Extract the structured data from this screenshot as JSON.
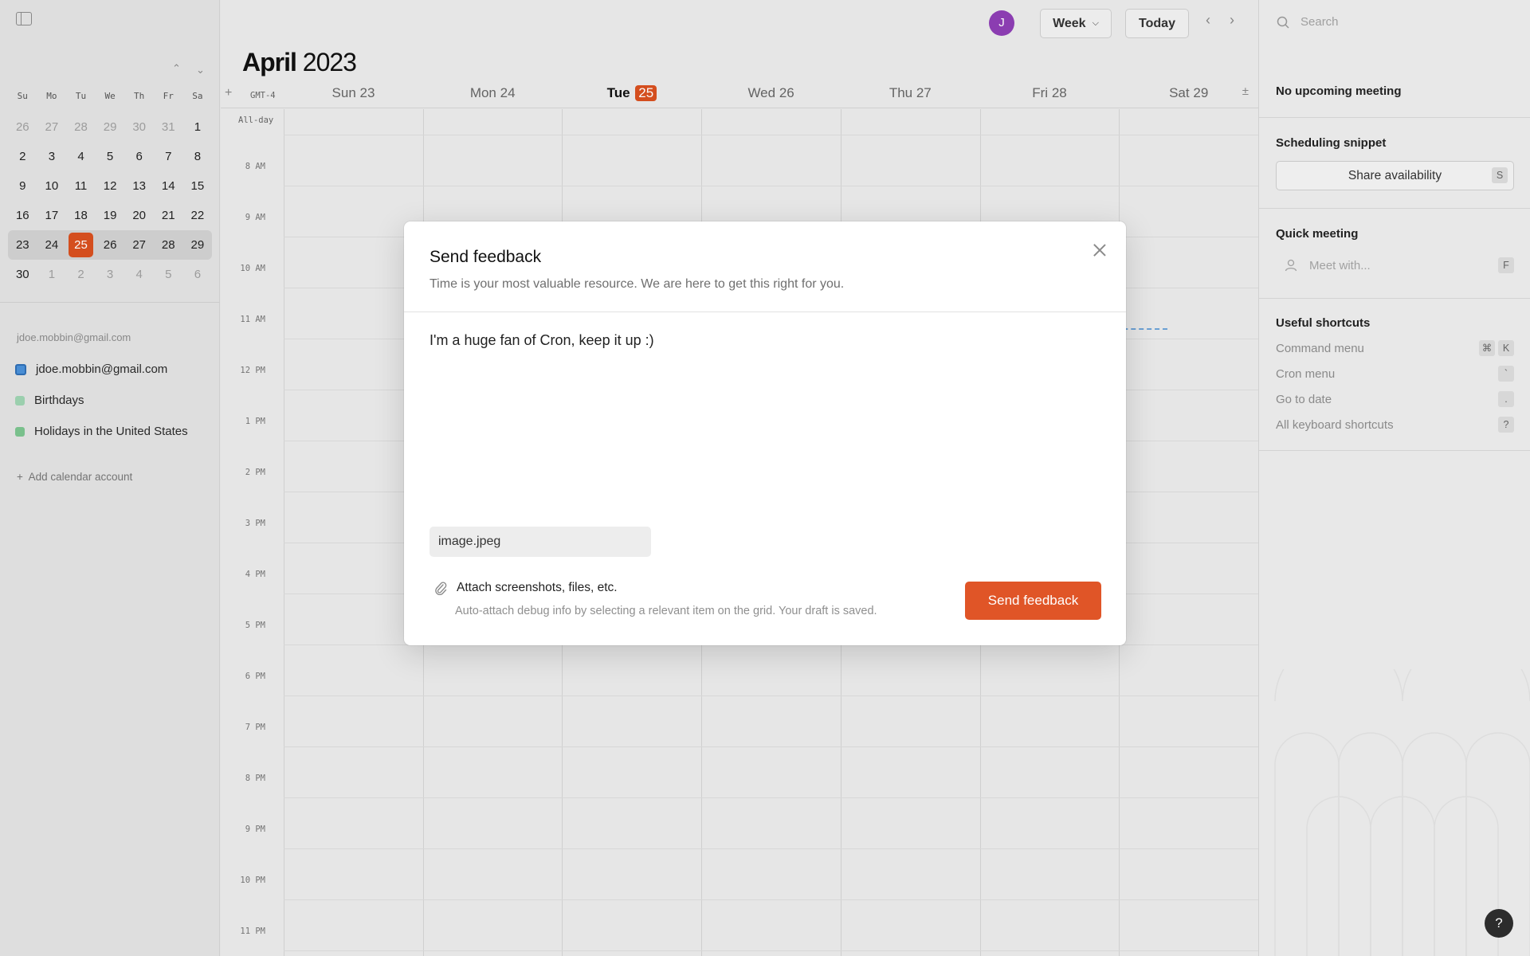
{
  "colors": {
    "accent": "#d9501f",
    "send_button": "#e05527",
    "avatar": "#8e3fb5",
    "calendar_primary": "#4a90d9",
    "calendar_birthdays": "#7dc49b",
    "calendar_holidays": "#6cbf84"
  },
  "sidebar": {
    "toggle_icon": "sidebar-toggle-icon",
    "mini_calendar": {
      "weekday_headers": [
        "Su",
        "Mo",
        "Tu",
        "We",
        "Th",
        "Fr",
        "Sa"
      ],
      "weeks": [
        [
          "26",
          "27",
          "28",
          "29",
          "30",
          "31",
          "1"
        ],
        [
          "2",
          "3",
          "4",
          "5",
          "6",
          "7",
          "8"
        ],
        [
          "9",
          "10",
          "11",
          "12",
          "13",
          "14",
          "15"
        ],
        [
          "16",
          "17",
          "18",
          "19",
          "20",
          "21",
          "22"
        ],
        [
          "23",
          "24",
          "25",
          "26",
          "27",
          "28",
          "29"
        ],
        [
          "30",
          "1",
          "2",
          "3",
          "4",
          "5",
          "6"
        ]
      ],
      "today": "25"
    },
    "account_label": "jdoe.mobbin@gmail.com",
    "calendars": [
      {
        "name": "jdoe.mobbin@gmail.com"
      },
      {
        "name": "Birthdays"
      },
      {
        "name": "Holidays in the United States"
      }
    ],
    "add_account": "Add calendar account"
  },
  "header": {
    "avatar_initial": "J",
    "view_select": "Week",
    "today_button": "Today",
    "month": "April",
    "year": "2023",
    "timezone": "GMT-4",
    "days": [
      {
        "name": "Sun",
        "date": "23"
      },
      {
        "name": "Mon",
        "date": "24"
      },
      {
        "name": "Tue",
        "date": "25"
      },
      {
        "name": "Wed",
        "date": "26"
      },
      {
        "name": "Thu",
        "date": "27"
      },
      {
        "name": "Fri",
        "date": "28"
      },
      {
        "name": "Sat",
        "date": "29"
      }
    ],
    "allday_label": "All-day",
    "hours": [
      "8 AM",
      "9 AM",
      "10 AM",
      "11 AM",
      "12 PM",
      "1 PM",
      "2 PM",
      "3 PM",
      "4 PM",
      "5 PM",
      "6 PM",
      "7 PM",
      "8 PM",
      "9 PM",
      "10 PM",
      "11 PM"
    ]
  },
  "right_panel": {
    "search_placeholder": "Search",
    "upcoming": "No upcoming meeting",
    "scheduling_heading": "Scheduling snippet",
    "share_label": "Share availability",
    "share_key": "S",
    "quick_heading": "Quick meeting",
    "meet_placeholder": "Meet with...",
    "meet_key": "F",
    "shortcuts_heading": "Useful shortcuts",
    "shortcuts": [
      {
        "label": "Command menu",
        "keys": [
          "⌘",
          "K"
        ]
      },
      {
        "label": "Cron menu",
        "keys": [
          "`"
        ]
      },
      {
        "label": "Go to date",
        "keys": [
          "."
        ]
      },
      {
        "label": "All keyboard shortcuts",
        "keys": [
          "?"
        ]
      }
    ],
    "help": "?"
  },
  "modal": {
    "title": "Send feedback",
    "subtitle": "Time is your most valuable resource. We are here to get this right for you.",
    "feedback_value": "I'm a huge fan of Cron, keep it up :)",
    "attachment": "image.jpeg",
    "attach_label": "Attach screenshots, files, etc.",
    "attach_hint": "Auto-attach debug info by selecting a relevant item on the grid. Your draft is saved.",
    "send_button": "Send feedback"
  }
}
